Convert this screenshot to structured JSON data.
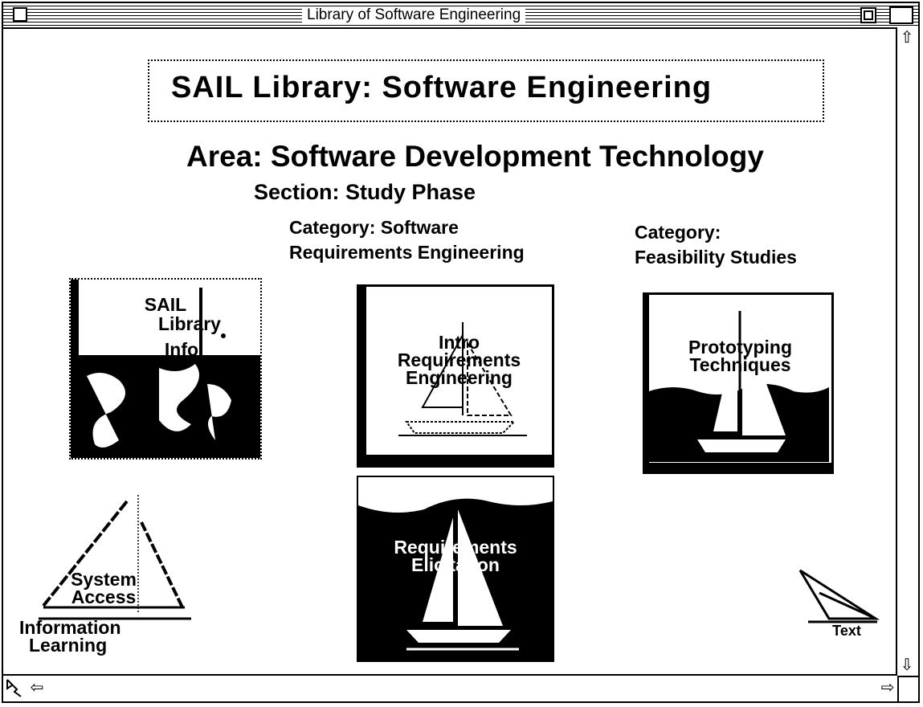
{
  "window": {
    "title": "Library of Software Engineering"
  },
  "header": {
    "title": "SAIL Library:  Software Engineering"
  },
  "area": {
    "text": "Area:  Software Development Technology"
  },
  "section": {
    "text": "Section:  Study Phase"
  },
  "categories": [
    {
      "line1": "Category:  Software",
      "line2": "Requirements Engineering"
    },
    {
      "line1": "Category:",
      "line2": "Feasibility Studies"
    }
  ],
  "tiles": {
    "sail_info": {
      "line1": "SAIL",
      "line2": "Library",
      "line3": "Info"
    },
    "intro_req": {
      "line1": "Intro",
      "line2": "Requirements",
      "line3": "Engineering"
    },
    "prototyping": {
      "line1": "Prototyping",
      "line2": "Techniques"
    },
    "req_elicitation": {
      "line1": "Requirements",
      "line2": "Elicitation"
    }
  },
  "system_access": {
    "line1": "System",
    "line2": "Access",
    "line3": "Information",
    "line4": "Learning"
  },
  "text_icon": {
    "label": "Text"
  },
  "icons": {
    "close": "close-box-icon",
    "zoom": "zoom-box-icon",
    "scroll_up": "up-arrow-icon",
    "scroll_down": "down-arrow-icon",
    "scroll_left": "left-arrow-icon",
    "scroll_right": "right-arrow-icon",
    "tool": "tool-icon"
  }
}
